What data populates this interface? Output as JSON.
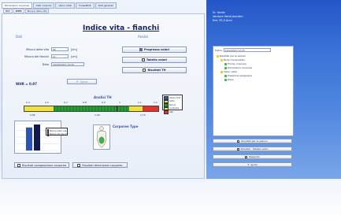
{
  "tabs": [
    "Dimensioni corporee",
    "Dati corporei",
    "Valori vitali",
    "Forza/BOK",
    "Dati generali"
  ],
  "subtabs": [
    "BMI",
    "WHR",
    "Misura della vita"
  ],
  "title": "Indice vita - fianchi",
  "sections": {
    "left": "Dati",
    "right": "Analisi"
  },
  "fields": {
    "waist_label": "Misura della vita",
    "waist_value": "86",
    "waist_unit": "[cm]",
    "hip_label": "Misura dei fianchi",
    "hip_value": "97",
    "hip_unit": "[cm]",
    "date_label": "Data",
    "date_value": "19/04/2007 13:25"
  },
  "buttons": {
    "progress": "Progresso valori",
    "table": "Tabella valori",
    "results": "Risultati TH",
    "save": "Salva",
    "body_comp": "Risultati composizione corporea",
    "body_dim": "Risultati dimensioni corporee"
  },
  "whr": "WHR = 0.97",
  "analysis_title": "Analisi TH",
  "scale_ticks": [
    "0.4",
    "0.5",
    "0.7",
    "0.8",
    "0.9",
    "1",
    "1.1",
    "1.2"
  ],
  "scale_bottom": [
    "0.85",
    "1.00",
    "1.15"
  ],
  "legend": [
    "Valore 0.97",
    "Sotto",
    "Buono",
    "Incidente",
    "Alto"
  ],
  "body_legend": [
    "Misura della vita",
    "Misura dei fianchi"
  ],
  "body_type": "Corporee Type",
  "right_header": {
    "line1": "Sr. Verde",
    "line2": "Verdura Verdi-monteri",
    "line3": "Età: 35,5 Anni"
  },
  "tree": {
    "label": "Datos:",
    "date": "19/04/2007 13:25",
    "items": [
      "Risultati per le sezioni",
      "Body Composition",
      "Forma corporea",
      "Dimensioni corporee",
      "Valori vitali",
      "Pressione sanguigna",
      "Polso"
    ]
  },
  "right_buttons": [
    "Risultati per le sezioni",
    "Risultati - Tabella valori",
    "Rapporto",
    "Ajuda"
  ],
  "chart_data": {
    "type": "bar",
    "categories": [
      "Misura della vita",
      "Misura dei fianchi"
    ],
    "values": [
      86,
      97
    ],
    "ylim": [
      0,
      100
    ]
  },
  "colors": {
    "accent": "#3f6fc4",
    "danger": "#e8302a",
    "good": "#1aa02a",
    "warn": "#f1e23a"
  }
}
